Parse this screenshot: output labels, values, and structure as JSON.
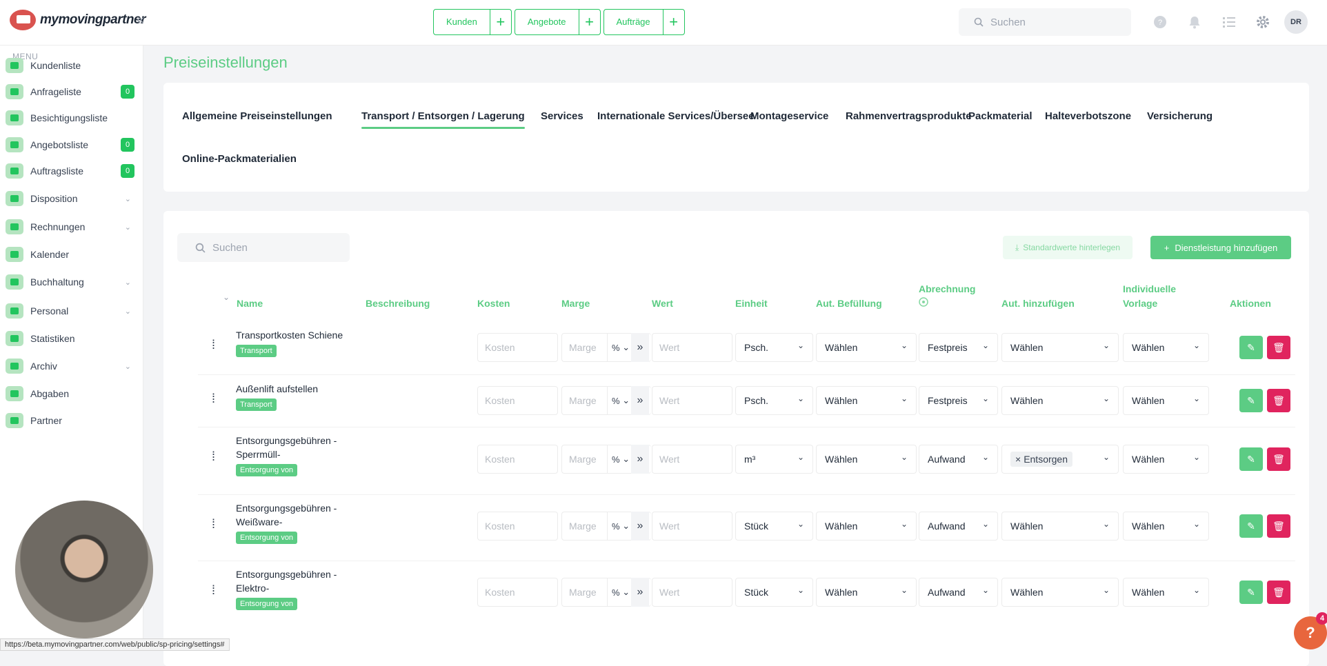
{
  "topbar": {
    "logo_text": "mymovingpartner",
    "collapse": "«",
    "quick": [
      {
        "label": "Kunden",
        "plus": "+"
      },
      {
        "label": "Angebote",
        "plus": "+"
      },
      {
        "label": "Aufträge",
        "plus": "+"
      }
    ],
    "search_placeholder": "Suchen",
    "avatar": "DR"
  },
  "sidebar": {
    "heading": "MENU",
    "items": [
      {
        "label": "Kundenliste",
        "badge": ""
      },
      {
        "label": "Anfrageliste",
        "badge": "0"
      },
      {
        "label": "Besichtigungsliste",
        "badge": ""
      },
      {
        "label": "Angebotsliste",
        "badge": "0"
      },
      {
        "label": "Auftragsliste",
        "badge": "0"
      },
      {
        "label": "Disposition",
        "badge": ""
      },
      {
        "label": "Rechnungen",
        "badge": ""
      },
      {
        "label": "Kalender",
        "badge": ""
      },
      {
        "label": "Buchhaltung",
        "badge": ""
      },
      {
        "label": "Personal",
        "badge": ""
      },
      {
        "label": "Statistiken",
        "badge": ""
      },
      {
        "label": "Archiv",
        "badge": ""
      },
      {
        "label": "Abgaben",
        "badge": ""
      },
      {
        "label": "Partner",
        "badge": ""
      }
    ]
  },
  "page": {
    "title": "Preiseinstellungen",
    "tabs": [
      "Allgemeine Preiseinstellungen",
      "Transport / Entsorgen / Lagerung",
      "Services",
      "Internationale Services/Übersee",
      "Montageservice",
      "Rahmenvertragsprodukte",
      "Packmaterial",
      "Halteverbotszone",
      "Versicherung",
      "Online-Packmaterialien"
    ],
    "active_tab": "Transport / Entsorgen / Lagerung"
  },
  "toolbar": {
    "search_placeholder": "Suchen",
    "std_button": "Standardwerte hinterlegen",
    "add_button": "Dienstleistung hinzufügen"
  },
  "table": {
    "headers": {
      "name": "Name",
      "beschreibung": "Beschreibung",
      "kosten": "Kosten",
      "marge": "Marge",
      "wert": "Wert",
      "einheit": "Einheit",
      "aut_befuellung": "Aut. Befüllung",
      "abrechnung": "Abrechnung",
      "aut_hinzufuegen": "Aut. hinzufügen",
      "individuelle_vorlage_1": "Individuelle",
      "individuelle_vorlage_2": "Vorlage",
      "aktionen": "Aktionen"
    },
    "placeholders": {
      "kosten": "Kosten",
      "marge": "Marge",
      "wert": "Wert",
      "pct": "%"
    },
    "rows": [
      {
        "name1": "Transportkosten Schiene",
        "name2": "",
        "tag": "Transport",
        "einheit": "Psch.",
        "befuellung": "Wählen",
        "abrechnung": "Festpreis",
        "hinzufuegen": "Wählen",
        "hinzufuegen_chip": "",
        "vorlage": "Wählen"
      },
      {
        "name1": "Außenlift aufstellen",
        "name2": "",
        "tag": "Transport",
        "einheit": "Psch.",
        "befuellung": "Wählen",
        "abrechnung": "Festpreis",
        "hinzufuegen": "Wählen",
        "hinzufuegen_chip": "",
        "vorlage": "Wählen"
      },
      {
        "name1": "Entsorgungsgebühren -",
        "name2": "Sperrmüll-",
        "tag": "Entsorgung von",
        "einheit": "m³",
        "befuellung": "Wählen",
        "abrechnung": "Aufwand",
        "hinzufuegen": "",
        "hinzufuegen_chip": "Entsorgen",
        "vorlage": "Wählen"
      },
      {
        "name1": "Entsorgungsgebühren -",
        "name2": "Weißware-",
        "tag": "Entsorgung von",
        "einheit": "Stück",
        "befuellung": "Wählen",
        "abrechnung": "Aufwand",
        "hinzufuegen": "Wählen",
        "hinzufuegen_chip": "",
        "vorlage": "Wählen"
      },
      {
        "name1": "Entsorgungsgebühren -",
        "name2": "Elektro-",
        "tag": "Entsorgung von",
        "einheit": "Stück",
        "befuellung": "Wählen",
        "abrechnung": "Aufwand",
        "hinzufuegen": "Wählen",
        "hinzufuegen_chip": "",
        "vorlage": "Wählen"
      }
    ]
  },
  "statusbar": "https://beta.mymovingpartner.com/web/public/sp-pricing/settings#",
  "help": {
    "label": "?",
    "count": "4"
  }
}
